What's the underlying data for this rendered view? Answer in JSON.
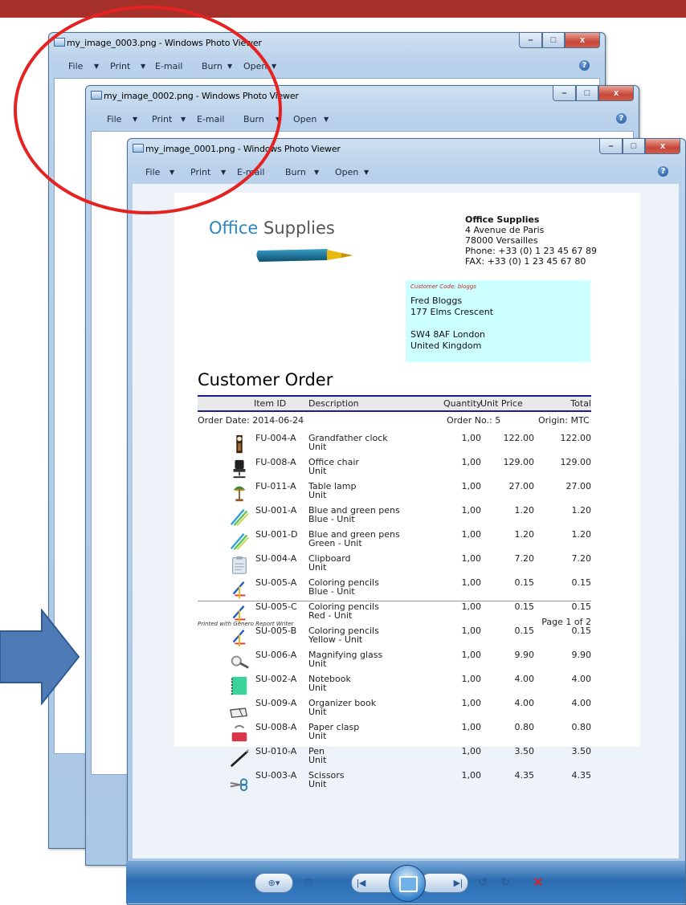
{
  "colors": {
    "banner": "#a5312a",
    "annotation_circle": "#e52222",
    "arrow": "#4e7bb5",
    "customer_box": "#ccffff"
  },
  "windows": [
    {
      "title": "my_image_0003.png - Windows Photo Viewer"
    },
    {
      "title": "my_image_0002.png - Windows Photo Viewer"
    },
    {
      "title": "my_image_0001.png - Windows Photo Viewer"
    }
  ],
  "menu": {
    "file": "File",
    "print": "Print",
    "email": "E-mail",
    "burn": "Burn",
    "open": "Open",
    "help": "?"
  },
  "window_buttons": {
    "minimize": "–",
    "maximize": "□",
    "close": "x"
  },
  "document": {
    "logo": {
      "part1": "Office",
      "part2": " Supplies"
    },
    "company": {
      "name": "Office Supplies",
      "line1": "4 Avenue de Paris",
      "line2": "78000 Versailles",
      "phone": "Phone: +33 (0) 1 23 45 67 89",
      "fax": "FAX:   +33 (0) 1 23 45 67 80"
    },
    "customer": {
      "code": "Customer Code: bloggs",
      "name": "Fred Bloggs",
      "street": "177 Elms Crescent",
      "city": "SW4 8AF London",
      "country": "United Kingdom"
    },
    "title": "Customer Order",
    "headers": {
      "item": "Item ID",
      "desc": "Description",
      "qty": "Quantity",
      "price": "Unit Price",
      "total": "Total"
    },
    "order_date": "Order Date: 2014-06-24",
    "order_no": "Order No.:  5",
    "origin": "Origin: MTC",
    "items": [
      {
        "icon": "clock-icon",
        "id": "FU-004-A",
        "desc": "Grandfather clock",
        "variant": "Unit",
        "qty": "1,00",
        "price": "122.00",
        "total": "122.00"
      },
      {
        "icon": "chair-icon",
        "id": "FU-008-A",
        "desc": "Office chair",
        "variant": "Unit",
        "qty": "1,00",
        "price": "129.00",
        "total": "129.00"
      },
      {
        "icon": "lamp-icon",
        "id": "FU-011-A",
        "desc": "Table lamp",
        "variant": "Unit",
        "qty": "1,00",
        "price": "27.00",
        "total": "27.00"
      },
      {
        "icon": "pens-icon",
        "id": "SU-001-A",
        "desc": "Blue and green pens",
        "variant": "Blue - Unit",
        "qty": "1,00",
        "price": "1.20",
        "total": "1.20"
      },
      {
        "icon": "pens-icon",
        "id": "SU-001-D",
        "desc": "Blue and green pens",
        "variant": "Green - Unit",
        "qty": "1,00",
        "price": "1.20",
        "total": "1.20"
      },
      {
        "icon": "clipboard-icon",
        "id": "SU-004-A",
        "desc": "Clipboard",
        "variant": "Unit",
        "qty": "1,00",
        "price": "7.20",
        "total": "7.20"
      },
      {
        "icon": "pencils-icon",
        "id": "SU-005-A",
        "desc": "Coloring pencils",
        "variant": "Blue - Unit",
        "qty": "1,00",
        "price": "0.15",
        "total": "0.15"
      },
      {
        "icon": "pencils-icon",
        "id": "SU-005-C",
        "desc": "Coloring pencils",
        "variant": "Red - Unit",
        "qty": "1,00",
        "price": "0.15",
        "total": "0.15"
      },
      {
        "icon": "pencils-icon",
        "id": "SU-005-B",
        "desc": "Coloring pencils",
        "variant": "Yellow - Unit",
        "qty": "1,00",
        "price": "0.15",
        "total": "0.15"
      },
      {
        "icon": "magnifier-icon",
        "id": "SU-006-A",
        "desc": "Magnifying glass",
        "variant": "Unit",
        "qty": "1,00",
        "price": "9.90",
        "total": "9.90"
      },
      {
        "icon": "notebook-icon",
        "id": "SU-002-A",
        "desc": "Notebook",
        "variant": "Unit",
        "qty": "1,00",
        "price": "4.00",
        "total": "4.00"
      },
      {
        "icon": "organizer-icon",
        "id": "SU-009-A",
        "desc": "Organizer book",
        "variant": "Unit",
        "qty": "1,00",
        "price": "4.00",
        "total": "4.00"
      },
      {
        "icon": "paperclasp-icon",
        "id": "SU-008-A",
        "desc": "Paper clasp",
        "variant": "Unit",
        "qty": "1,00",
        "price": "0.80",
        "total": "0.80"
      },
      {
        "icon": "pen-icon",
        "id": "SU-010-A",
        "desc": "Pen",
        "variant": "Unit",
        "qty": "1,00",
        "price": "3.50",
        "total": "3.50"
      },
      {
        "icon": "scissors-icon",
        "id": "SU-003-A",
        "desc": "Scissors",
        "variant": "Unit",
        "qty": "1,00",
        "price": "4.35",
        "total": "4.35"
      }
    ],
    "footer": {
      "printed": "Printed with Genero Report Writer",
      "page": "Page 1 of 2"
    }
  },
  "viewer_toolbar": {
    "zoom": "zoom-icon",
    "fit": "fit-icon",
    "prev": "previous-icon",
    "slideshow": "slideshow-icon",
    "next": "next-icon",
    "rotate_ccw": "rotate-left-icon",
    "rotate_cw": "rotate-right-icon",
    "delete": "delete-icon"
  }
}
